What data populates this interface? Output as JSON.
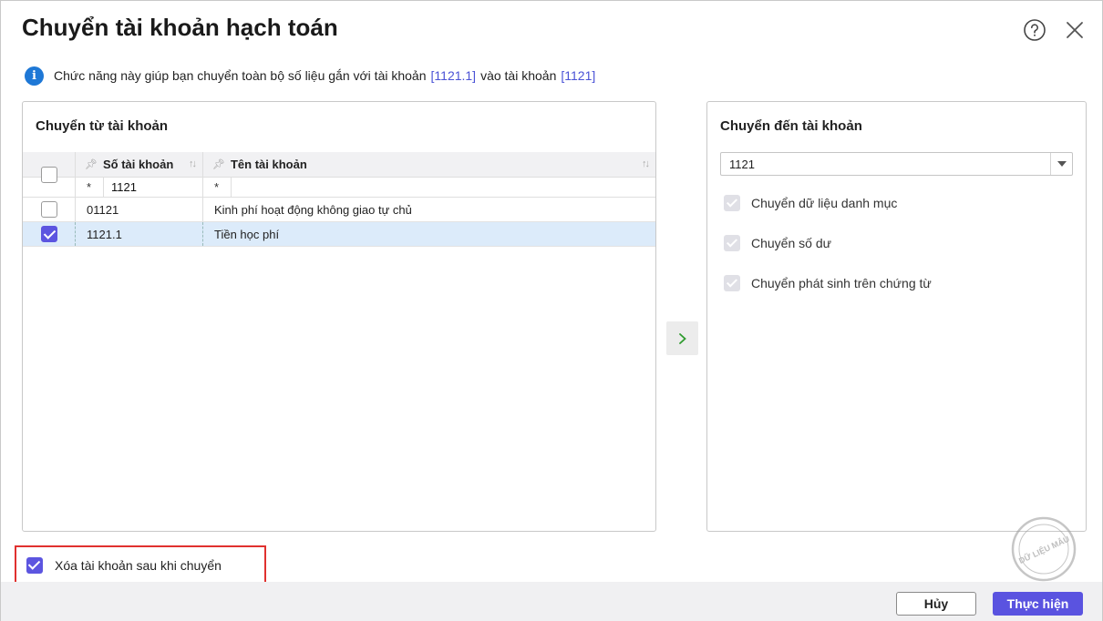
{
  "dialog": {
    "title": "Chuyển tài khoản hạch toán",
    "info": {
      "text_before": "Chức năng này giúp bạn chuyển toàn bộ số liệu gắn với tài khoản",
      "from_account_link": "[1121.1]",
      "text_middle": "vào tài khoản",
      "to_account_link": "[1121]"
    }
  },
  "left_panel": {
    "title": "Chuyển từ tài khoản",
    "columns": [
      "Số tài khoản",
      "Tên tài khoản"
    ],
    "filter": {
      "num_operator": "*",
      "num_value": "1121",
      "name_operator": "*",
      "name_value": ""
    },
    "rows": [
      {
        "checked": false,
        "number": "01121",
        "name": "Kinh phí hoạt động không giao tự chủ"
      },
      {
        "checked": true,
        "number": "1121.1",
        "name": "Tiền học phí"
      }
    ]
  },
  "right_panel": {
    "title": "Chuyển đến tài khoản",
    "selected_account": "1121",
    "options": [
      {
        "label": "Chuyển dữ liệu danh mục",
        "checked": true,
        "disabled": true
      },
      {
        "label": "Chuyển số dư",
        "checked": true,
        "disabled": true
      },
      {
        "label": "Chuyển phát sinh trên chứng từ",
        "checked": true,
        "disabled": true
      }
    ]
  },
  "delete_after": {
    "label": "Xóa tài khoản sau khi chuyển",
    "checked": true
  },
  "footer": {
    "cancel_label": "Hủy",
    "ok_label": "Thực hiện"
  },
  "watermark": {
    "text": "DỮ LIỆU MẪU"
  },
  "colors": {
    "accent": "#5a53e0",
    "info": "#1e78d6",
    "link": "#4a52d6",
    "highlight": "#e0312f",
    "selected_row": "#dcebfa"
  },
  "icons": {
    "help": "help-circle-icon",
    "close": "close-icon",
    "info": "info-icon",
    "arrow": "chevron-right-icon",
    "dropdown": "caret-down-icon"
  }
}
